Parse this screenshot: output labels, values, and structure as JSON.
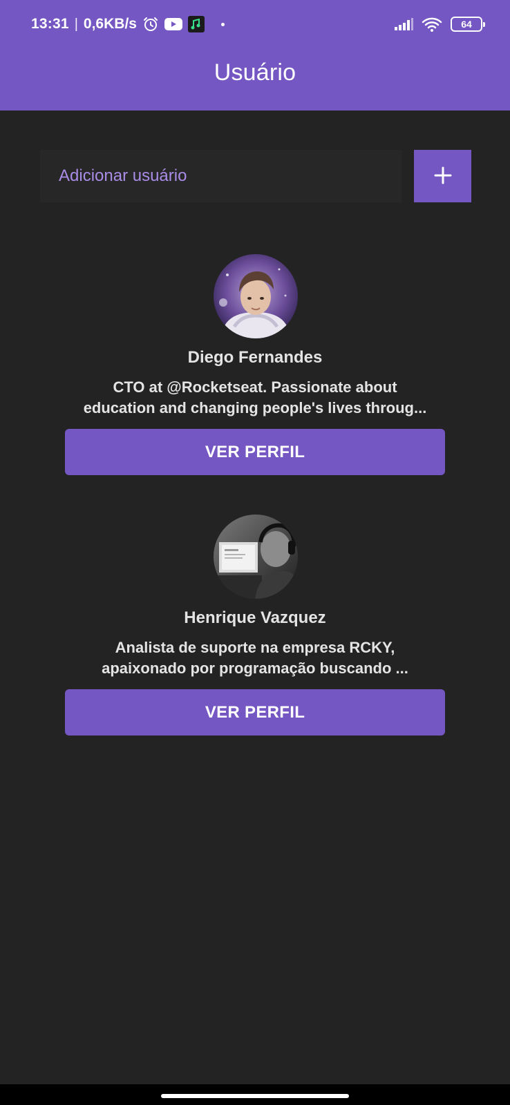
{
  "status_bar": {
    "time": "13:31",
    "separator": "|",
    "network_speed": "0,6KB/s",
    "battery_level": "64",
    "icons": [
      "alarm-icon",
      "youtube-icon",
      "music-app-icon",
      "notification-dot",
      "signal-icon",
      "wifi-icon",
      "battery-icon"
    ]
  },
  "app_bar": {
    "title": "Usuário"
  },
  "add_user": {
    "placeholder": "Adicionar usuário",
    "button_icon": "plus-icon"
  },
  "users": [
    {
      "name": "Diego Fernandes",
      "bio_line1": "CTO at @Rocketseat. Passionate about",
      "bio_line2": "education and changing people's lives throug...",
      "button_label": "VER PERFIL"
    },
    {
      "name": "Henrique Vazquez",
      "bio_line1": "Analista de suporte na empresa RCKY,",
      "bio_line2": "apaixonado por programação buscando ...",
      "button_label": "VER PERFIL"
    }
  ],
  "colors": {
    "primary": "#7457c2",
    "background": "#232323",
    "input_background": "#272727",
    "placeholder": "#a98ce6",
    "text": "#e4e4e4"
  }
}
